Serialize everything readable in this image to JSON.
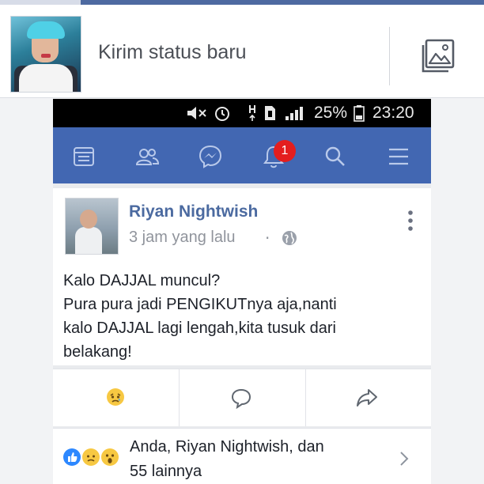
{
  "composer": {
    "prompt": "Kirim status baru",
    "photo_icon": "photo-gallery-icon"
  },
  "phone_status": {
    "battery": "25%",
    "time": "23:20",
    "icons": [
      "mute-icon",
      "alarm-icon",
      "hspa-icon",
      "sim-icon",
      "signal-icon",
      "battery-icon"
    ]
  },
  "nav": {
    "icons": [
      "news-feed-icon",
      "friends-icon",
      "messenger-icon",
      "notifications-icon",
      "search-icon",
      "menu-icon"
    ],
    "notification_count": "1",
    "accent": "#4267b2",
    "badge_color": "#e41e1e"
  },
  "post": {
    "author": "Riyan Nightwish",
    "time": "3 jam yang lalu",
    "separator": "·",
    "privacy_icon": "globe-icon",
    "lines": [
      "Kalo DAJJAL muncul?",
      "Pura pura jadi PENGIKUTnya aja,nanti",
      "kalo DAJJAL lagi lengah,kita tusuk dari",
      "belakang!"
    ],
    "author_color": "#4b6aa0"
  },
  "actions": {
    "icons": [
      "sad-reaction-icon",
      "comment-icon",
      "share-icon"
    ]
  },
  "reactions": {
    "icons": [
      "like-reaction-icon",
      "sad-reaction-icon",
      "wow-reaction-icon"
    ],
    "summary_line1": "Anda, Riyan Nightwish, dan",
    "summary_line2": "55 lainnya"
  }
}
